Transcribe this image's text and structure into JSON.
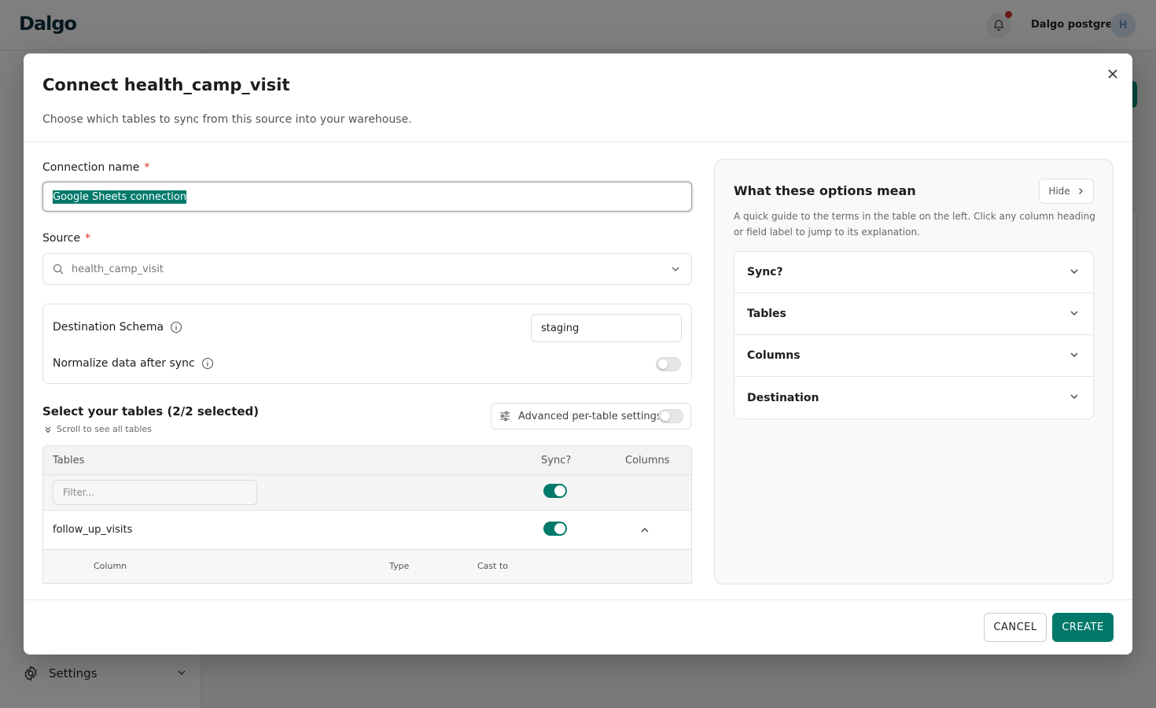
{
  "app": {
    "logo": "Dalgo",
    "org_name": "Dalgo postgres",
    "avatar_initial": "H",
    "sidebar_settings": "Settings"
  },
  "dialog": {
    "title": "Connect health_camp_visit",
    "subtitle": "Choose which tables to sync from this source into your warehouse.",
    "connection_name_label": "Connection name",
    "connection_name_value": "Google Sheets connection",
    "required_mark": "*",
    "source_label": "Source",
    "source_value": "health_camp_visit",
    "destination_schema_label": "Destination Schema",
    "destination_schema_value": "staging",
    "normalize_label": "Normalize data after sync",
    "normalize_on": false,
    "select_tables_title": "Select your tables (2/2 selected)",
    "scroll_hint": "Scroll to see all tables",
    "advanced_label": "Advanced per-table settings",
    "advanced_on": false,
    "table": {
      "headers": [
        "Tables",
        "Sync?",
        "Columns"
      ],
      "filter_placeholder": "Filter...",
      "select_all_sync": true,
      "rows": [
        {
          "name": "follow_up_visits",
          "sync": true,
          "expanded": true
        }
      ],
      "sub_headers": [
        "Column",
        "Type",
        "Cast to"
      ]
    },
    "guide": {
      "title": "What these options mean",
      "hide_label": "Hide",
      "description": "A quick guide to the terms in the table on the left. Click any column heading or field label to jump to its explanation.",
      "items": [
        "Sync?",
        "Tables",
        "Columns",
        "Destination"
      ]
    },
    "cancel_label": "CANCEL",
    "create_label": "CREATE"
  },
  "colors": {
    "accent": "#00796b",
    "required": "#d9302c"
  }
}
